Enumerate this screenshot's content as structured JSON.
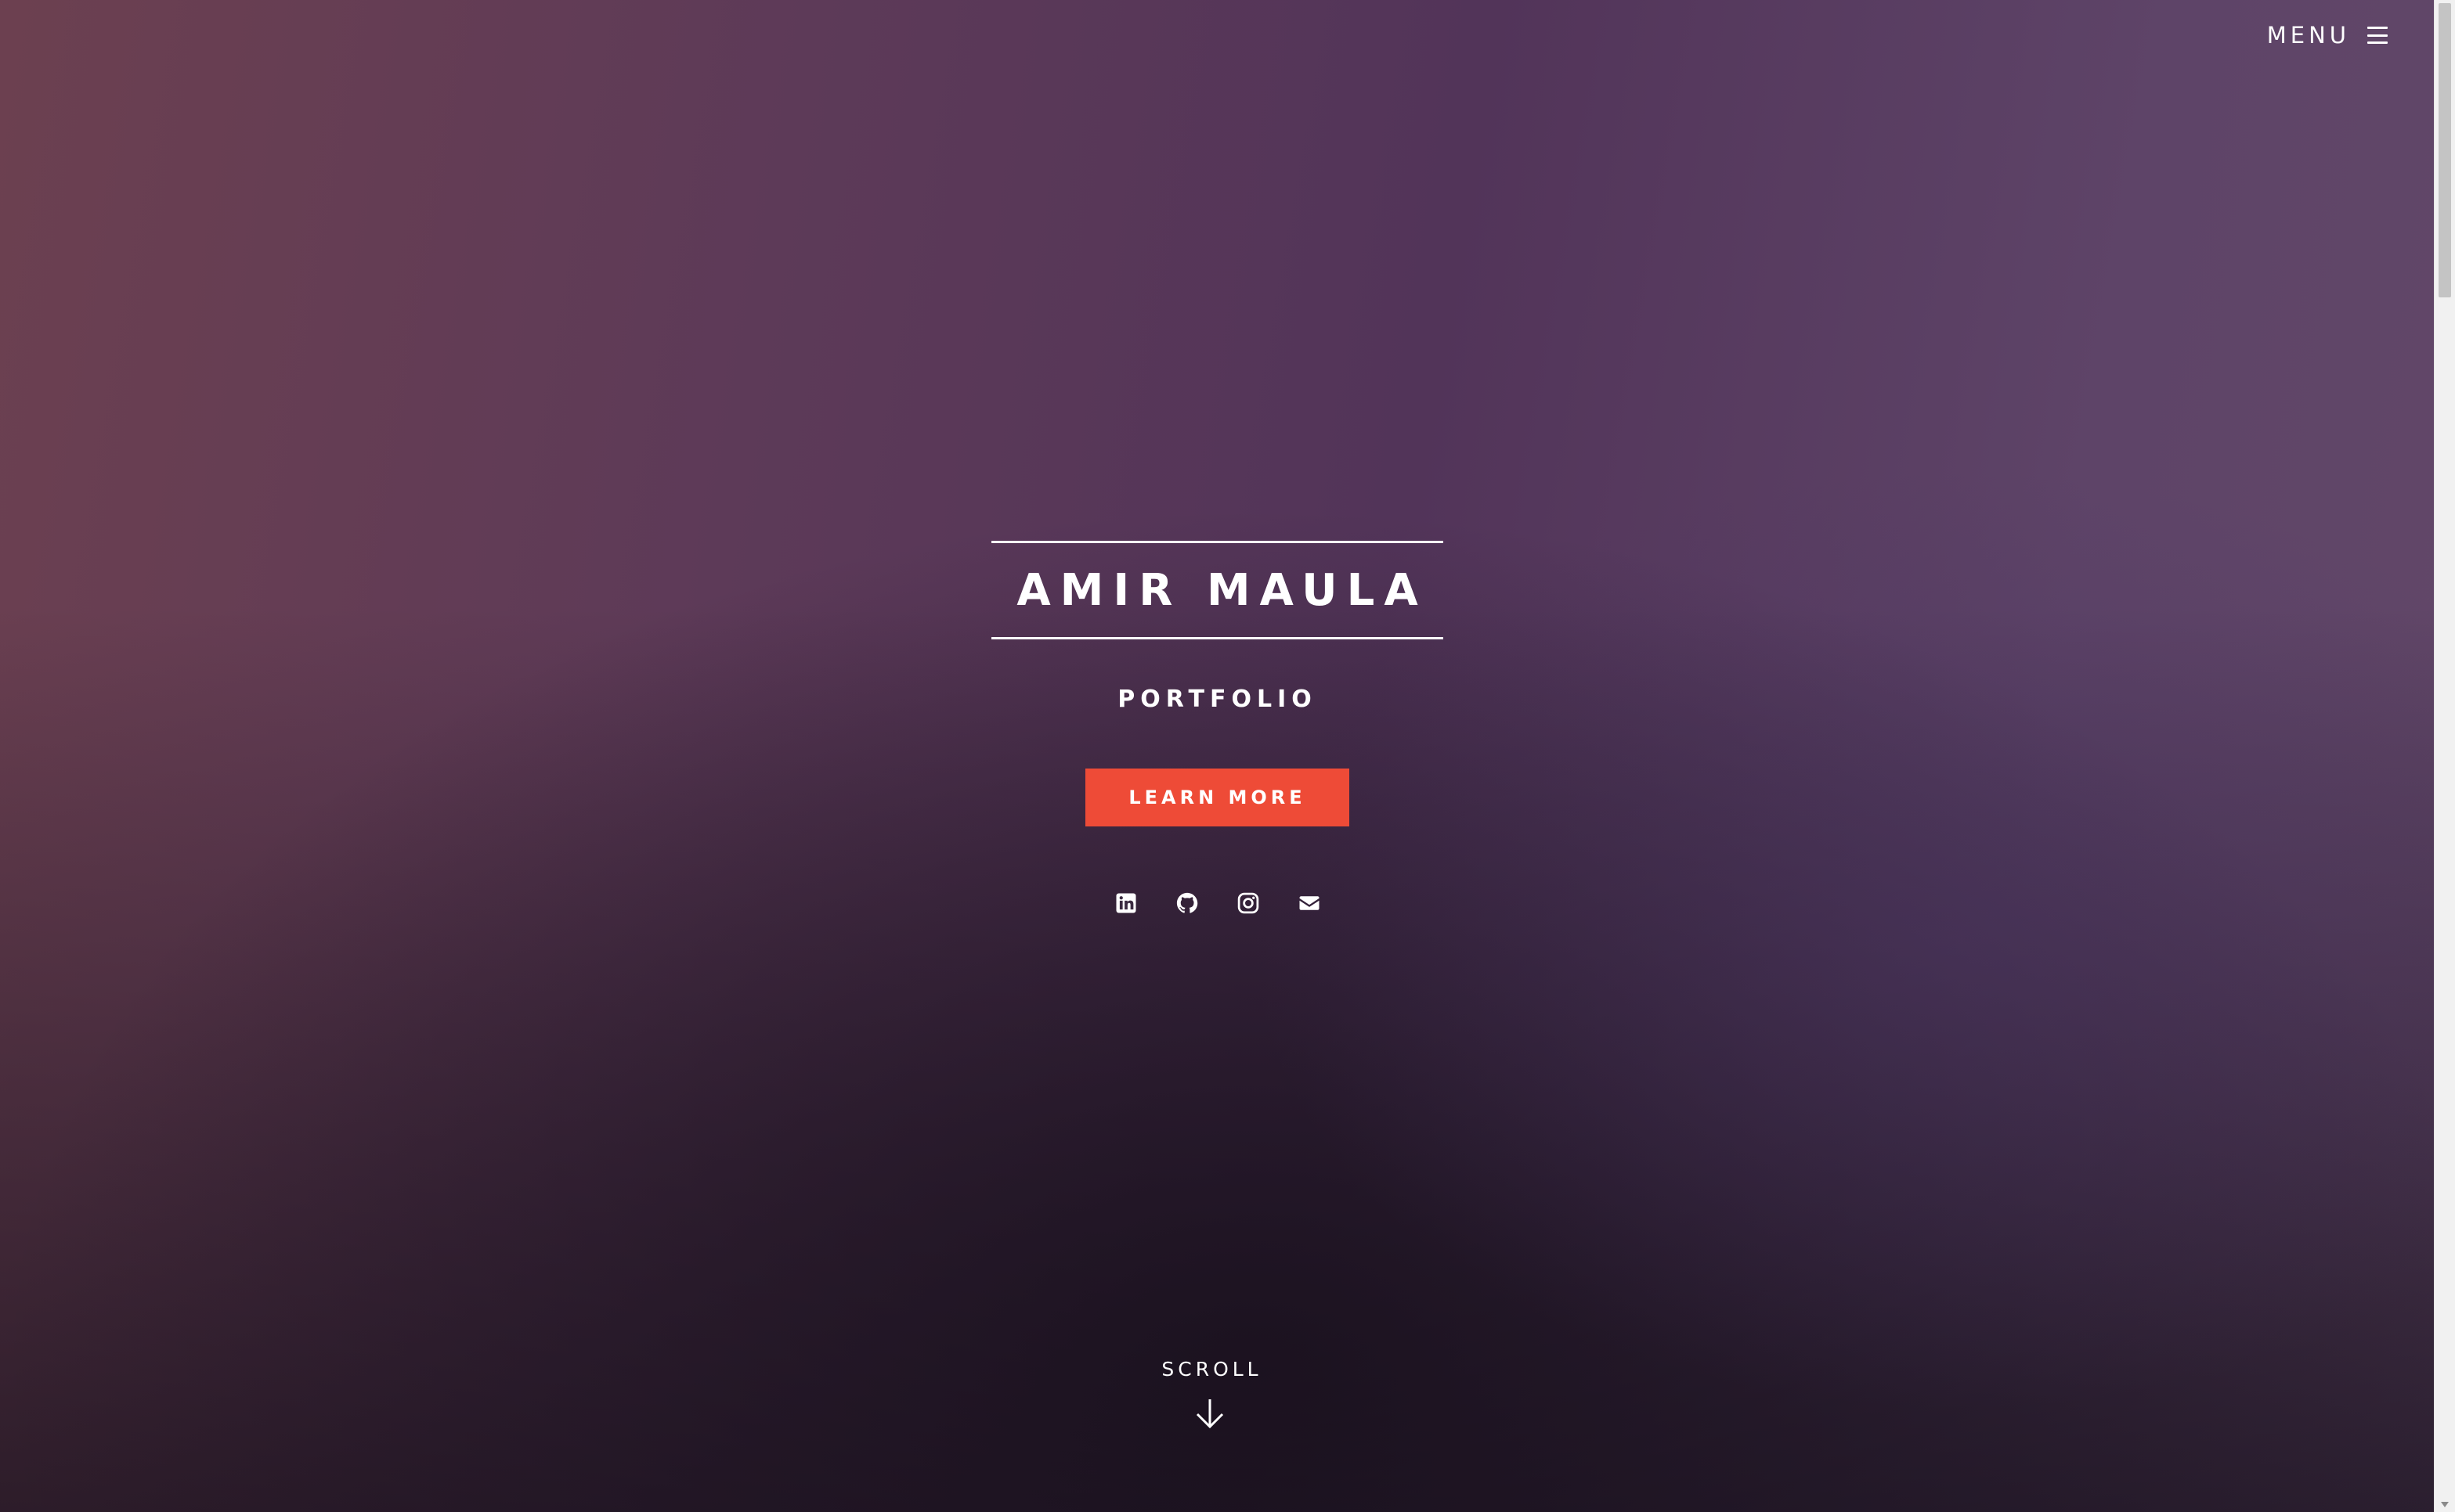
{
  "header": {
    "menu_label": "MENU"
  },
  "hero": {
    "title": "AMIR MAULA",
    "subtitle": "PORTFOLIO",
    "cta_label": "LEARN MORE",
    "socials": [
      {
        "icon": "linkedin-icon"
      },
      {
        "icon": "github-icon"
      },
      {
        "icon": "instagram-icon"
      },
      {
        "icon": "envelope-icon"
      }
    ],
    "scroll_label": "SCROLL"
  },
  "colors": {
    "accent": "#ee4b37",
    "text": "#ffffff",
    "background_top_left": "#6c4050",
    "background_bottom": "#1e1620"
  }
}
